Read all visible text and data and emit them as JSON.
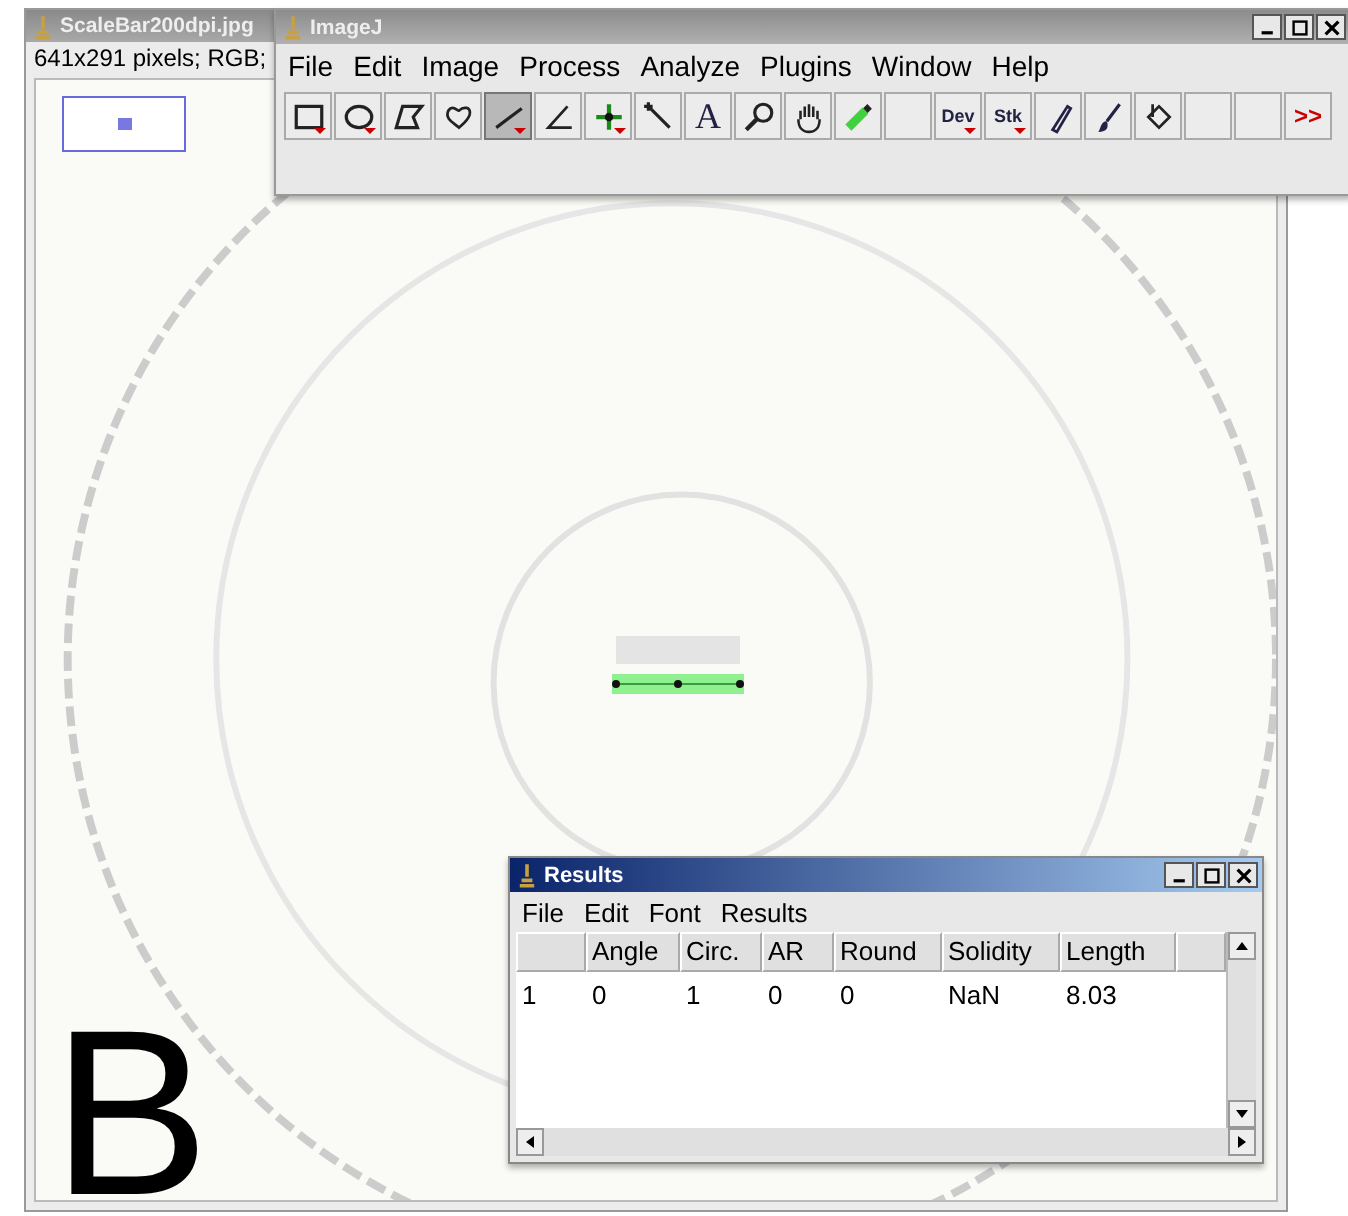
{
  "image_window": {
    "title": "ScaleBar200dpi.jpg",
    "info": "641x291 pixels; RGB;",
    "letter": "B"
  },
  "imagej": {
    "title": "ImageJ",
    "menu": [
      "File",
      "Edit",
      "Image",
      "Process",
      "Analyze",
      "Plugins",
      "Window",
      "Help"
    ],
    "tools": [
      {
        "kind": "rect",
        "selected": false,
        "dropdown": true
      },
      {
        "kind": "oval",
        "selected": false,
        "dropdown": true
      },
      {
        "kind": "polygon",
        "selected": false,
        "dropdown": false
      },
      {
        "kind": "freehand",
        "selected": false,
        "dropdown": false
      },
      {
        "kind": "line",
        "selected": true,
        "dropdown": true
      },
      {
        "kind": "angle",
        "selected": false,
        "dropdown": false
      },
      {
        "kind": "point",
        "selected": false,
        "dropdown": true
      },
      {
        "kind": "wand",
        "selected": false,
        "dropdown": false
      },
      {
        "kind": "label",
        "label": "A",
        "selected": false,
        "dropdown": false
      },
      {
        "kind": "magnifier",
        "selected": false,
        "dropdown": false
      },
      {
        "kind": "hand",
        "selected": false,
        "dropdown": false
      },
      {
        "kind": "dropper",
        "selected": false,
        "dropdown": false
      },
      {
        "kind": "blank",
        "selected": false,
        "dropdown": false
      },
      {
        "kind": "label",
        "label": "Dev",
        "selected": false,
        "dropdown": true
      },
      {
        "kind": "label",
        "label": "Stk",
        "selected": false,
        "dropdown": true
      },
      {
        "kind": "pencil",
        "selected": false,
        "dropdown": false
      },
      {
        "kind": "brush",
        "selected": false,
        "dropdown": false
      },
      {
        "kind": "fill",
        "selected": false,
        "dropdown": false
      },
      {
        "kind": "blank",
        "selected": false,
        "dropdown": false
      },
      {
        "kind": "blank",
        "selected": false,
        "dropdown": false
      },
      {
        "kind": "more",
        "label": ">>",
        "selected": false,
        "dropdown": false
      }
    ]
  },
  "results": {
    "title": "Results",
    "menu": [
      "File",
      "Edit",
      "Font",
      "Results"
    ],
    "columns": [
      "",
      "Angle",
      "Circ.",
      "AR",
      "Round",
      "Solidity",
      "Length"
    ],
    "rows": [
      [
        "1",
        "0",
        "1",
        "0",
        "0",
        "NaN",
        "8.03"
      ]
    ]
  }
}
